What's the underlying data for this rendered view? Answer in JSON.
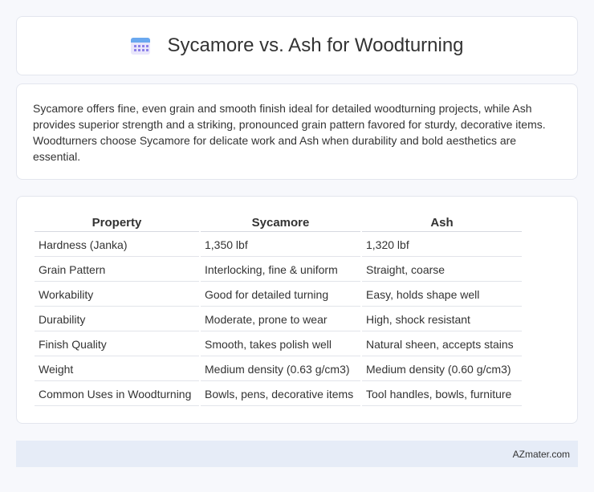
{
  "header": {
    "title": "Sycamore vs. Ash for Woodturning",
    "icon": "calendar-icon"
  },
  "summary": {
    "text": "Sycamore offers fine, even grain and smooth finish ideal for detailed woodturning projects, while Ash provides superior strength and a striking, pronounced grain pattern favored for sturdy, decorative items. Woodturners choose Sycamore for delicate work and Ash when durability and bold aesthetics are essential."
  },
  "table": {
    "headers": [
      "Property",
      "Sycamore",
      "Ash"
    ],
    "rows": [
      [
        "Hardness (Janka)",
        "1,350 lbf",
        "1,320 lbf"
      ],
      [
        "Grain Pattern",
        "Interlocking, fine & uniform",
        "Straight, coarse"
      ],
      [
        "Workability",
        "Good for detailed turning",
        "Easy, holds shape well"
      ],
      [
        "Durability",
        "Moderate, prone to wear",
        "High, shock resistant"
      ],
      [
        "Finish Quality",
        "Smooth, takes polish well",
        "Natural sheen, accepts stains"
      ],
      [
        "Weight",
        "Medium density (0.63 g/cm3)",
        "Medium density (0.60 g/cm3)"
      ],
      [
        "Common Uses in Woodturning",
        "Bowls, pens, decorative items",
        "Tool handles, bowls, furniture"
      ]
    ]
  },
  "footer": {
    "brand": "AZmater.com"
  },
  "colors": {
    "background": "#f7f8fc",
    "card": "#ffffff",
    "footer": "#e6ecf7",
    "icon_accent": "#8b7fe8",
    "icon_top": "#6aa8ef"
  }
}
